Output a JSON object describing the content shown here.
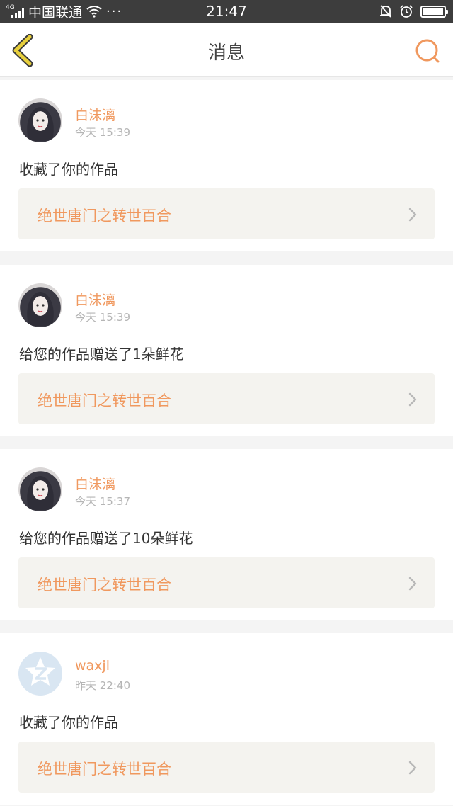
{
  "status_bar": {
    "network": "4G",
    "carrier": "中国联通",
    "more": "···",
    "time": "21:47"
  },
  "header": {
    "title": "消息",
    "back_icon": "chevron-left-icon",
    "search_icon": "search-icon",
    "accent_color": "#f0985e",
    "back_color": "#e7cf3c"
  },
  "messages": [
    {
      "user": "白沫漓",
      "time": "今天 15:39",
      "text": "收藏了你的作品",
      "work": "绝世唐门之转世百合",
      "avatar": "anime"
    },
    {
      "user": "白沫漓",
      "time": "今天 15:39",
      "text": "给您的作品赠送了1朵鲜花",
      "work": "绝世唐门之转世百合",
      "avatar": "anime"
    },
    {
      "user": "白沫漓",
      "time": "今天 15:37",
      "text": "给您的作品赠送了10朵鲜花",
      "work": "绝世唐门之转世百合",
      "avatar": "anime"
    },
    {
      "user": "waxjl",
      "time": "昨天 22:40",
      "text": "收藏了你的作品",
      "work": "绝世唐门之转世百合",
      "avatar": "default"
    }
  ]
}
